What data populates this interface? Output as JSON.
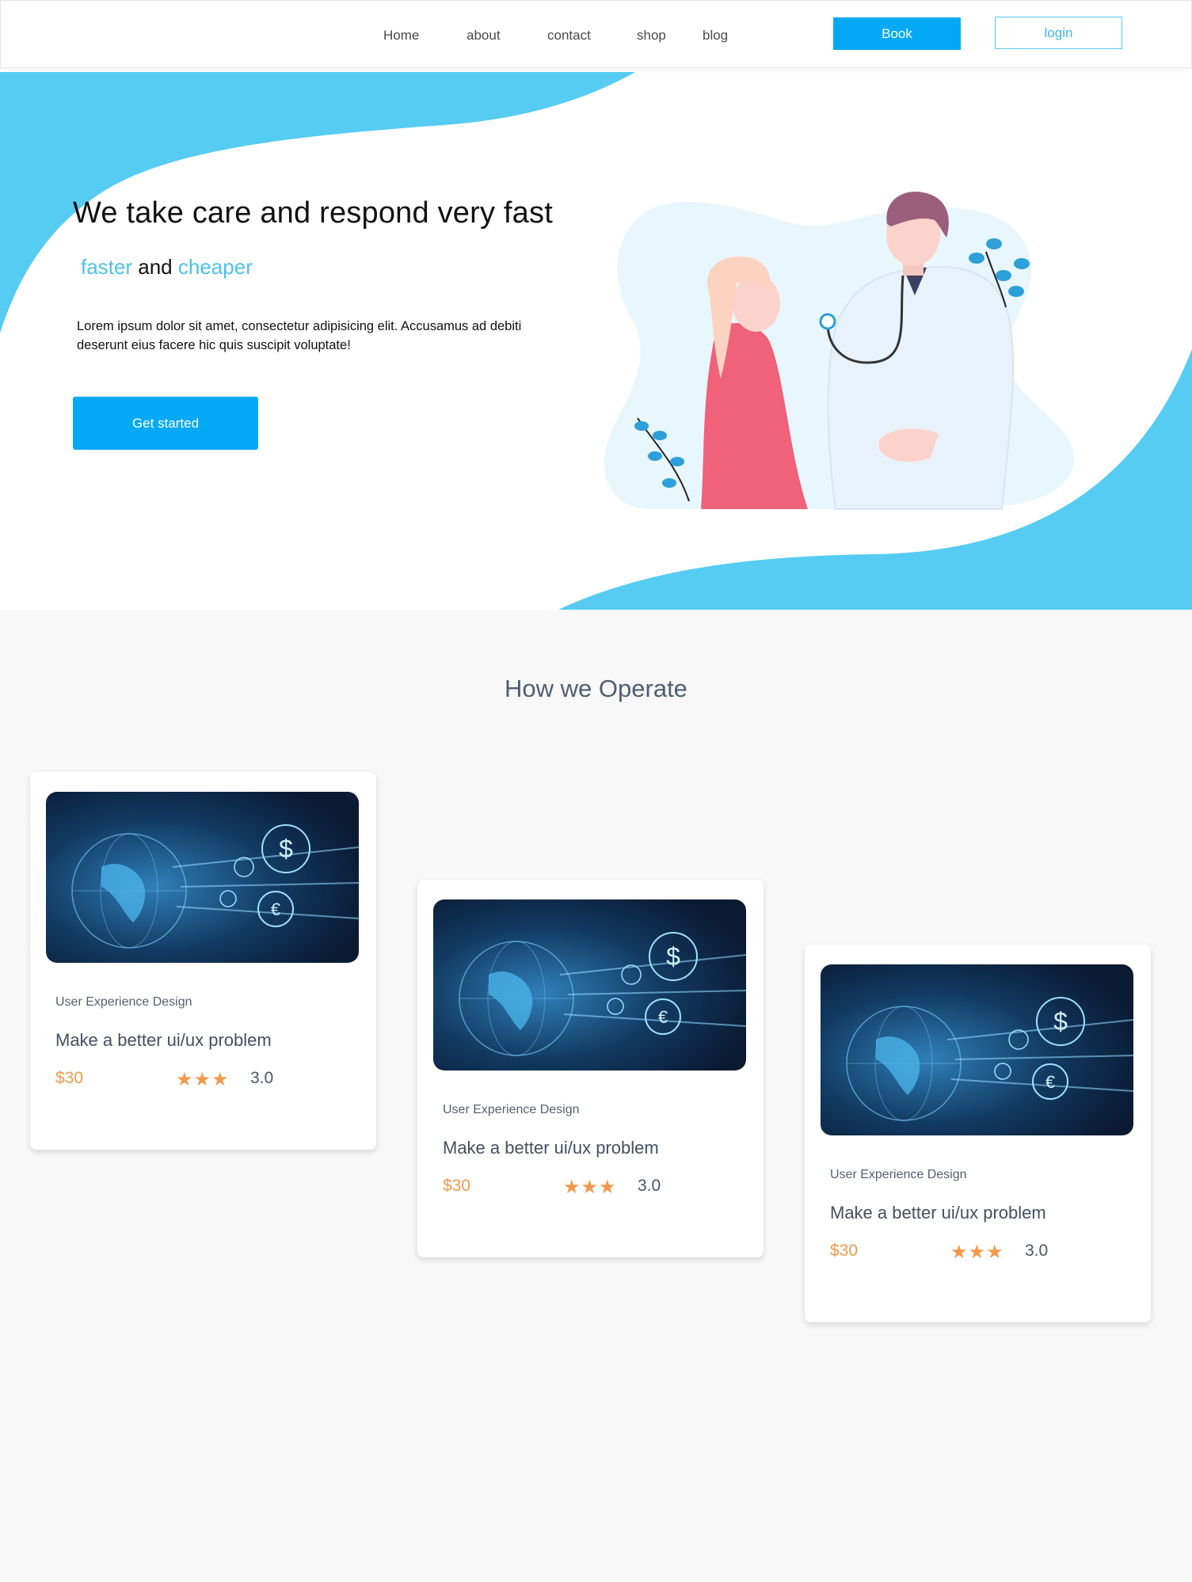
{
  "nav": {
    "links": [
      "Home",
      "about",
      "contact",
      "shop",
      "blog"
    ],
    "book_label": "Book",
    "login_label": "login"
  },
  "hero": {
    "title": "We take care and respond very fast",
    "subtitle_word1": "faster",
    "subtitle_and": "and",
    "subtitle_word2": "cheaper",
    "description": "Lorem ipsum dolor sit amet, consectetur adipisicing elit. Accusamus ad debiti deserunt eius facere hic quis suscipit voluptate!",
    "cta_label": "Get started"
  },
  "section": {
    "title": "How we Operate"
  },
  "cards": [
    {
      "category": "User Experience Design",
      "title": "Make a better ui/ux problem",
      "price": "$30",
      "stars": "★★★",
      "rating": "3.0"
    },
    {
      "category": "User Experience Design",
      "title": "Make a better ui/ux problem",
      "price": "$30",
      "stars": "★★★",
      "rating": "3.0"
    },
    {
      "category": "User Experience Design",
      "title": "Make a better ui/ux problem",
      "price": "$30",
      "stars": "★★★",
      "rating": "3.0"
    }
  ],
  "colors": {
    "primary": "#04a9f5",
    "wave": "#56ccf2",
    "accent_text": "#4dc1ea",
    "price": "#f2994a",
    "section_title": "#4f5d75"
  },
  "icons": {
    "star": "star-icon",
    "hero_image": "doctor-patient-illustration",
    "card_image": "globe-finance-image"
  }
}
